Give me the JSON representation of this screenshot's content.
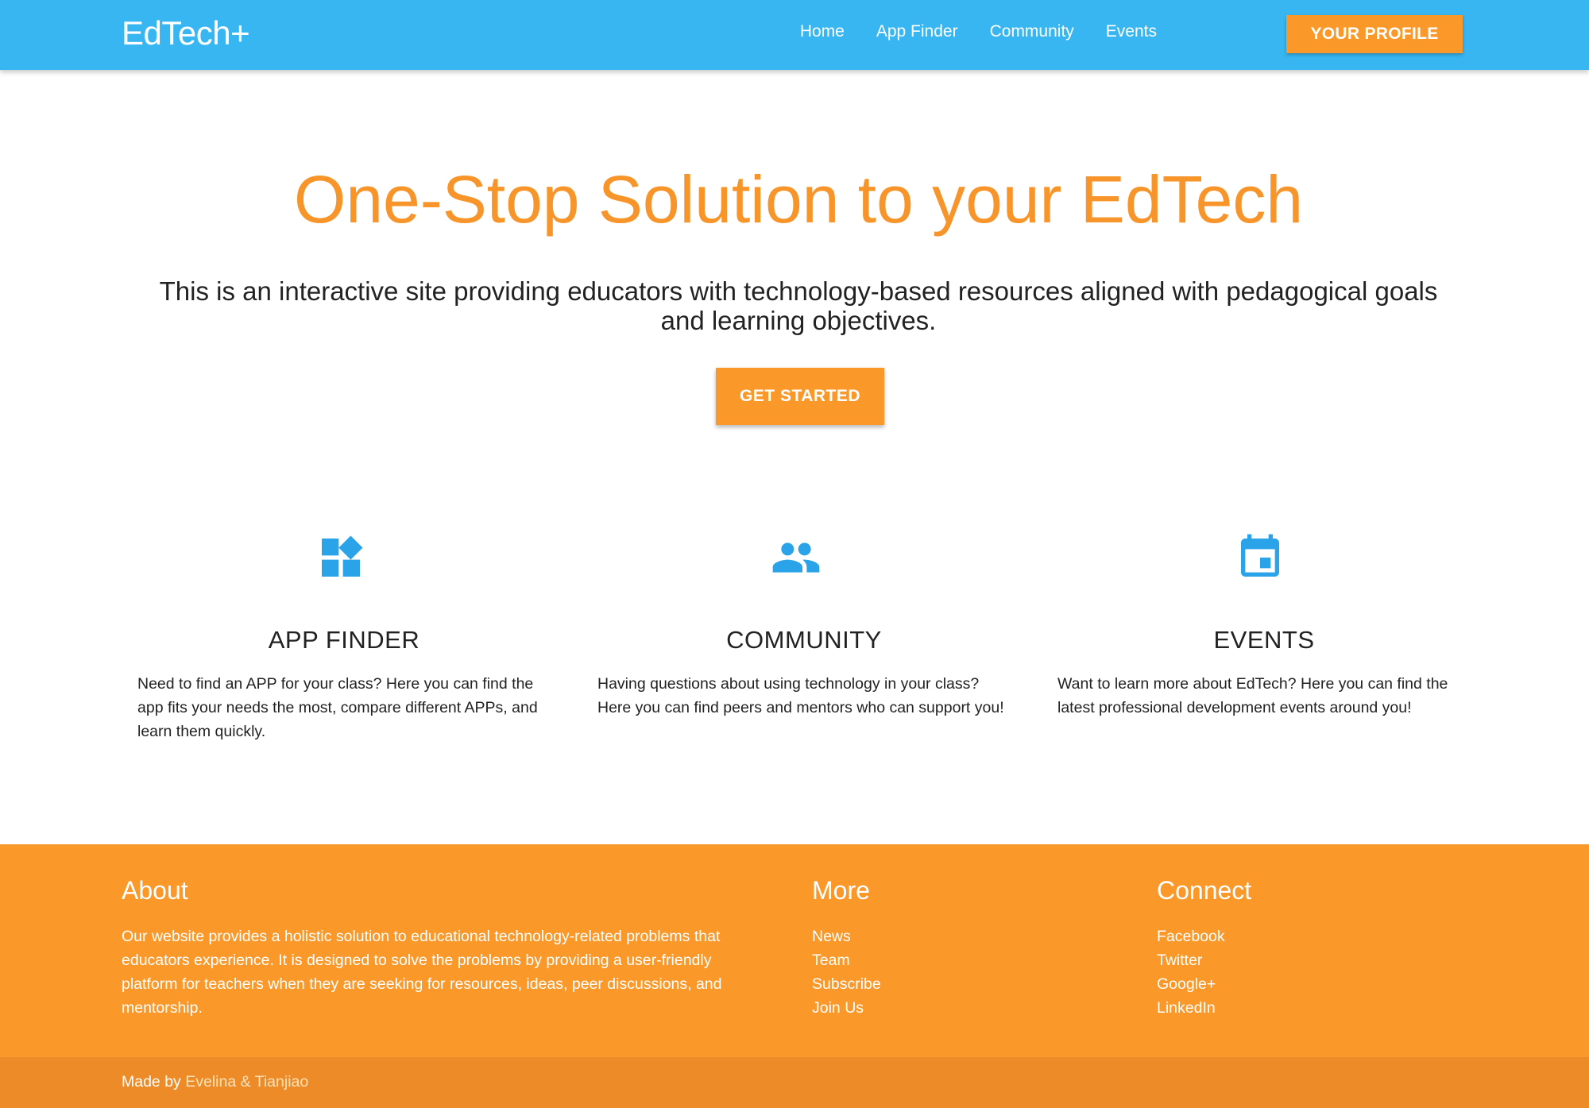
{
  "colors": {
    "nav": "#38b6f1",
    "accent": "#fb982a",
    "title": "#f7952a",
    "icon": "#2aa3e8",
    "subfooter": "#ec8b27"
  },
  "nav": {
    "brand": "EdTech+",
    "links": [
      "Home",
      "App Finder",
      "Community",
      "Events"
    ],
    "profile_button": "YOUR PROFILE"
  },
  "hero": {
    "title": "One-Stop Solution to your EdTech",
    "description": "This is an interactive site providing educators with technology-based resources aligned with pedagogical goals and learning objectives.",
    "cta": "GET STARTED"
  },
  "features": [
    {
      "icon": "widgets-icon",
      "title": "APP FINDER",
      "text": "Need to find an APP for your class? Here you can find the app fits your needs the most, compare different APPs, and learn them quickly."
    },
    {
      "icon": "people-icon",
      "title": "COMMUNITY",
      "text": "Having questions about using technology in your class? Here you can find peers and mentors who can support you!"
    },
    {
      "icon": "calendar-icon",
      "title": "EVENTS",
      "text": "Want to learn more about EdTech? Here you can find the latest professional development events around you!"
    }
  ],
  "footer": {
    "about": {
      "title": "About",
      "text": "Our website provides a holistic solution to educational technology-related problems that educators experience. It is designed to solve the problems by providing a user-friendly platform for teachers when they are seeking for resources, ideas, peer discussions, and mentorship."
    },
    "more": {
      "title": "More",
      "links": [
        "News",
        "Team",
        "Subscribe",
        "Join Us"
      ]
    },
    "connect": {
      "title": "Connect",
      "links": [
        "Facebook",
        "Twitter",
        "Google+",
        "LinkedIn"
      ]
    },
    "credit_prefix": "Made by ",
    "credit_authors": "Evelina & Tianjiao"
  }
}
